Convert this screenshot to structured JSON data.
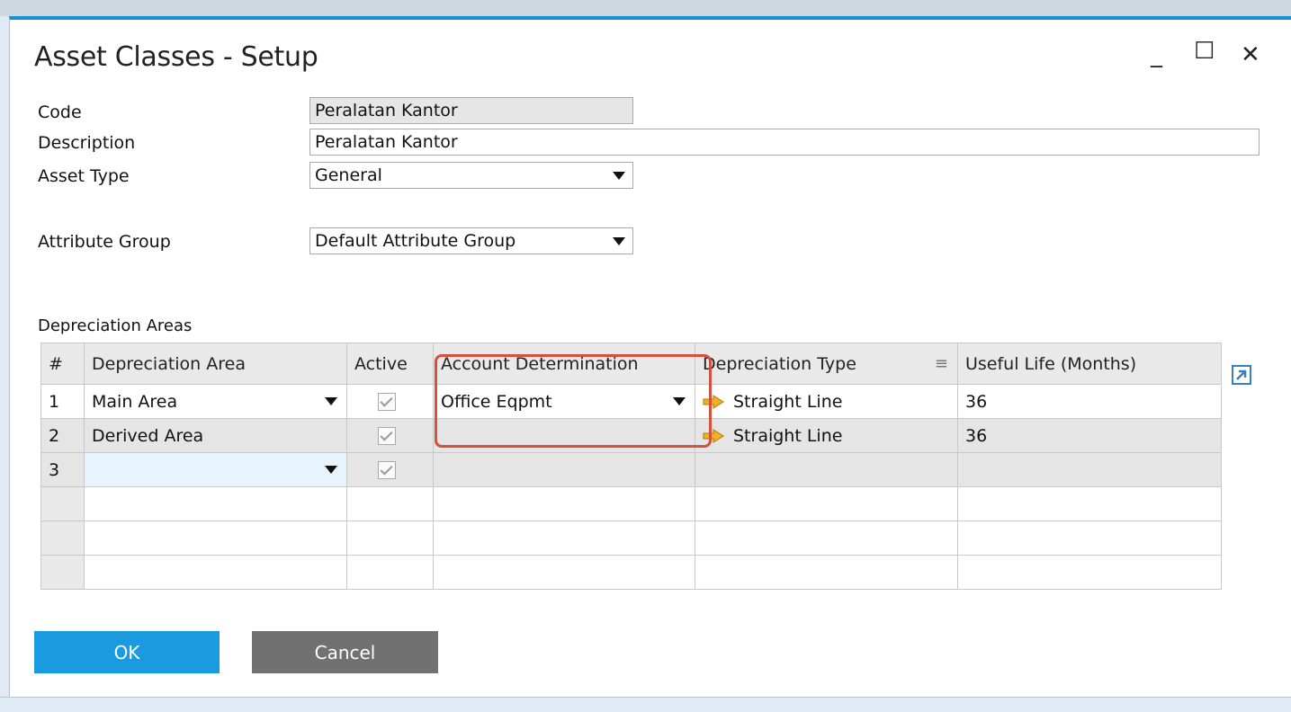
{
  "window": {
    "title": "Asset Classes - Setup",
    "controls": {
      "minimize": "_",
      "maximize": "☐",
      "close": "✕"
    }
  },
  "form": {
    "code": {
      "label": "Code",
      "value": "Peralatan Kantor"
    },
    "description": {
      "label": "Description",
      "value": "Peralatan Kantor"
    },
    "asset_type": {
      "label": "Asset Type",
      "value": "General"
    },
    "attribute_group": {
      "label": "Attribute Group",
      "value": "Default Attribute Group"
    }
  },
  "depreciation": {
    "section_label": "Depreciation Areas",
    "columns": [
      "#",
      "Depreciation Area",
      "Active",
      "Account Determination",
      "Depreciation Type",
      "Useful Life (Months)"
    ],
    "rows": [
      {
        "num": "1",
        "area": "Main Area",
        "active": true,
        "account": "Office Eqpmt",
        "type": "Straight Line",
        "life": "36"
      },
      {
        "num": "2",
        "area": "Derived Area",
        "active": true,
        "account": "",
        "type": "Straight Line",
        "life": "36"
      },
      {
        "num": "3",
        "area": "",
        "active": true,
        "account": "",
        "type": "",
        "life": ""
      }
    ]
  },
  "buttons": {
    "ok": "OK",
    "cancel": "Cancel"
  },
  "colors": {
    "accent": "#1a9be0",
    "highlight": "#d5503d",
    "cancel": "#717171"
  }
}
